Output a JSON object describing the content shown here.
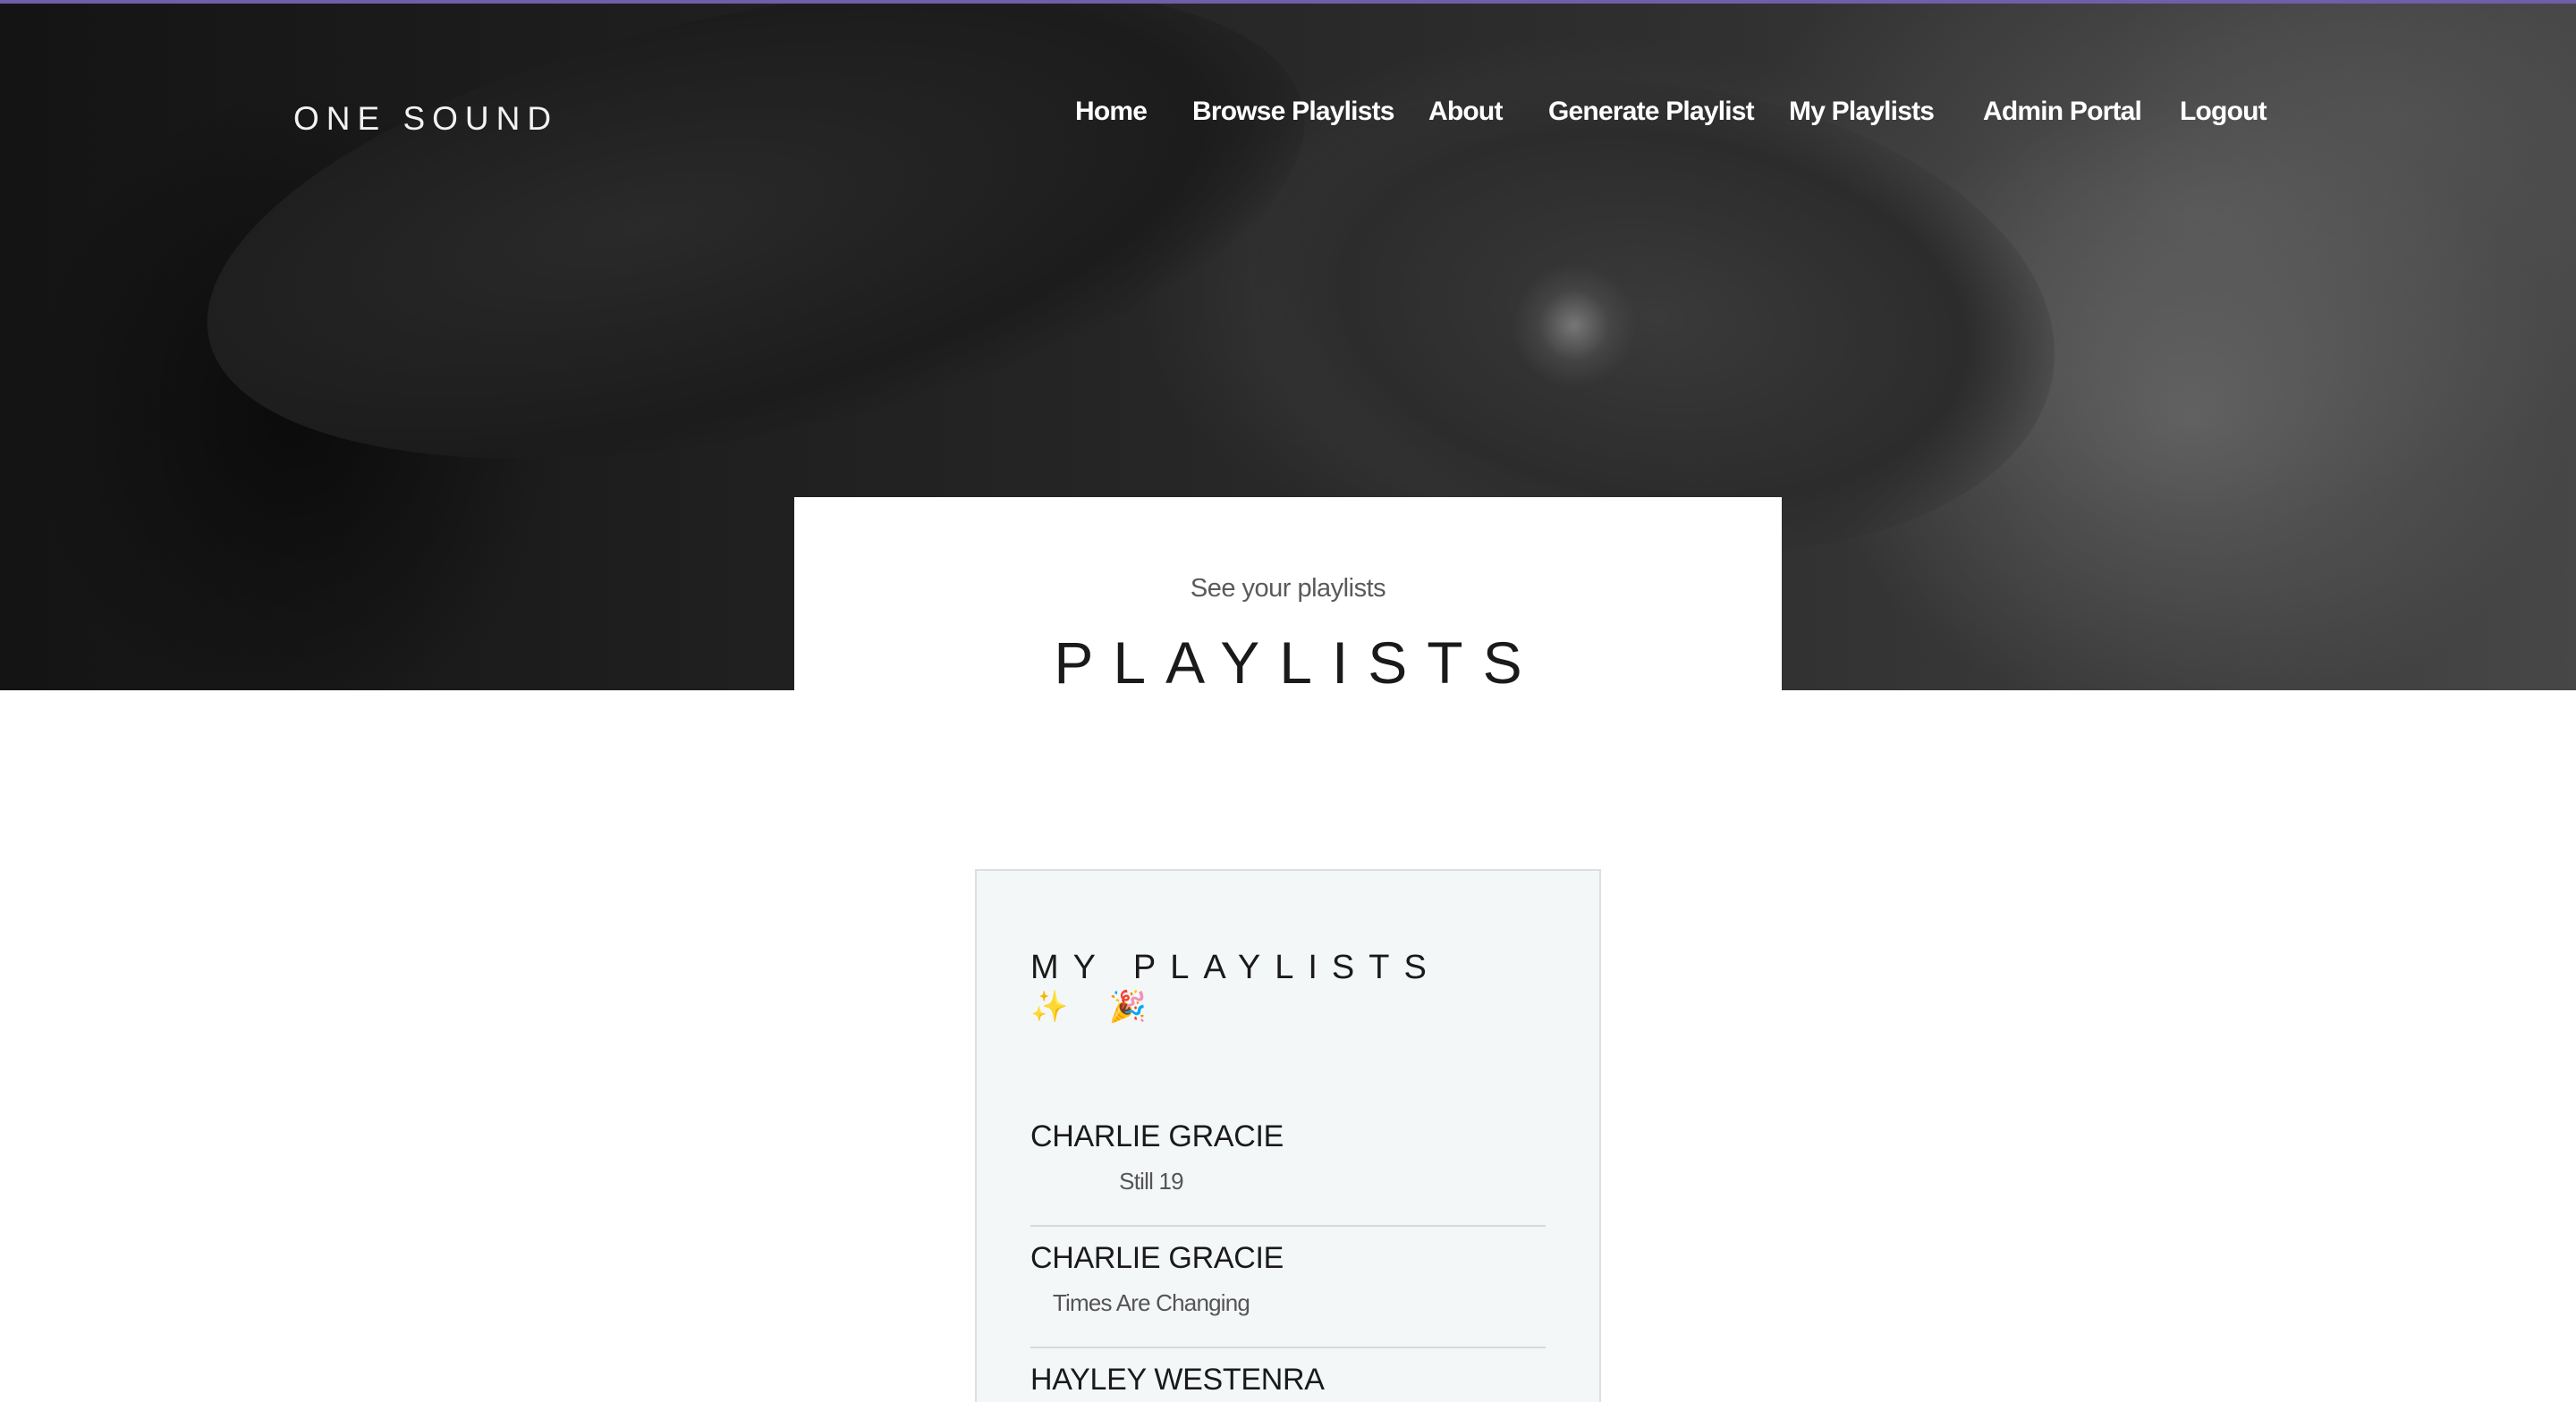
{
  "header": {
    "brand": "ONE SOUND",
    "nav": [
      {
        "label": "Home"
      },
      {
        "label": "Browse Playlists"
      },
      {
        "label": "About"
      },
      {
        "label": "Generate Playlist"
      },
      {
        "label": "My Playlists"
      },
      {
        "label": "Admin Portal"
      },
      {
        "label": "Logout"
      }
    ]
  },
  "hero": {
    "subtitle": "See your playlists",
    "title": "PLAYLISTS"
  },
  "panel": {
    "heading": "MY PLAYLISTS",
    "emoji": "✨ 🎉",
    "playlists": [
      {
        "artist": "CHARLIE GRACIE",
        "song": "Still 19"
      },
      {
        "artist": "CHARLIE GRACIE",
        "song": "Times Are Changing"
      },
      {
        "artist": "HAYLEY WESTENRA",
        "song": ""
      }
    ]
  },
  "colors": {
    "accent_top_border": "#6f5fa8",
    "panel_background": "#f4f7f8",
    "text_dark": "#1a1a1a"
  }
}
